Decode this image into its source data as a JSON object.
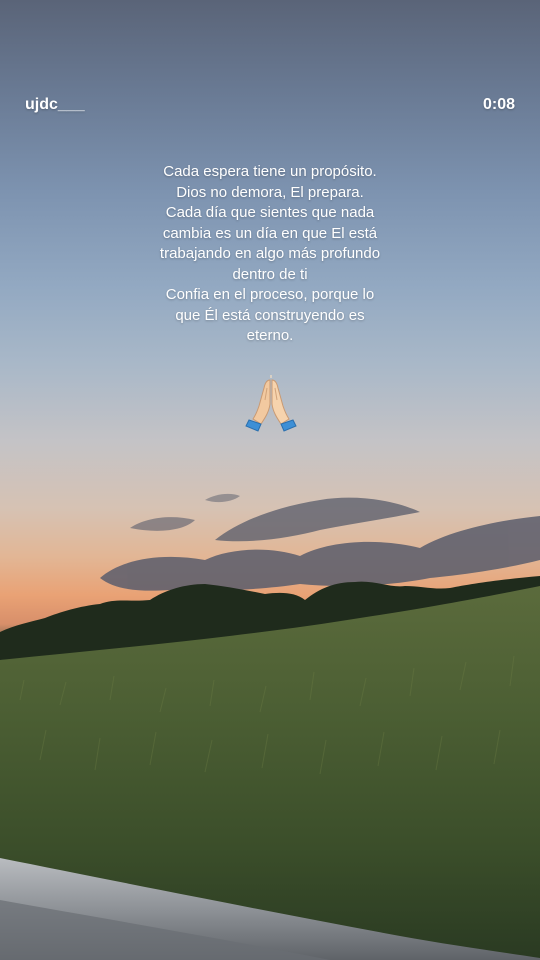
{
  "story": {
    "username": "ujdc___",
    "timer": "0:08",
    "caption_lines": [
      "Cada espera tiene un propósito.",
      "Dios no demora, El prepara.",
      "Cada día que sientes que nada",
      "cambia es un día en que El está",
      "trabajando en algo más profundo",
      "dentro de ti",
      "Confia en el proceso, porque lo",
      "que Él está construyendo es",
      "eterno."
    ],
    "emoji": "folded-hands-icon"
  }
}
